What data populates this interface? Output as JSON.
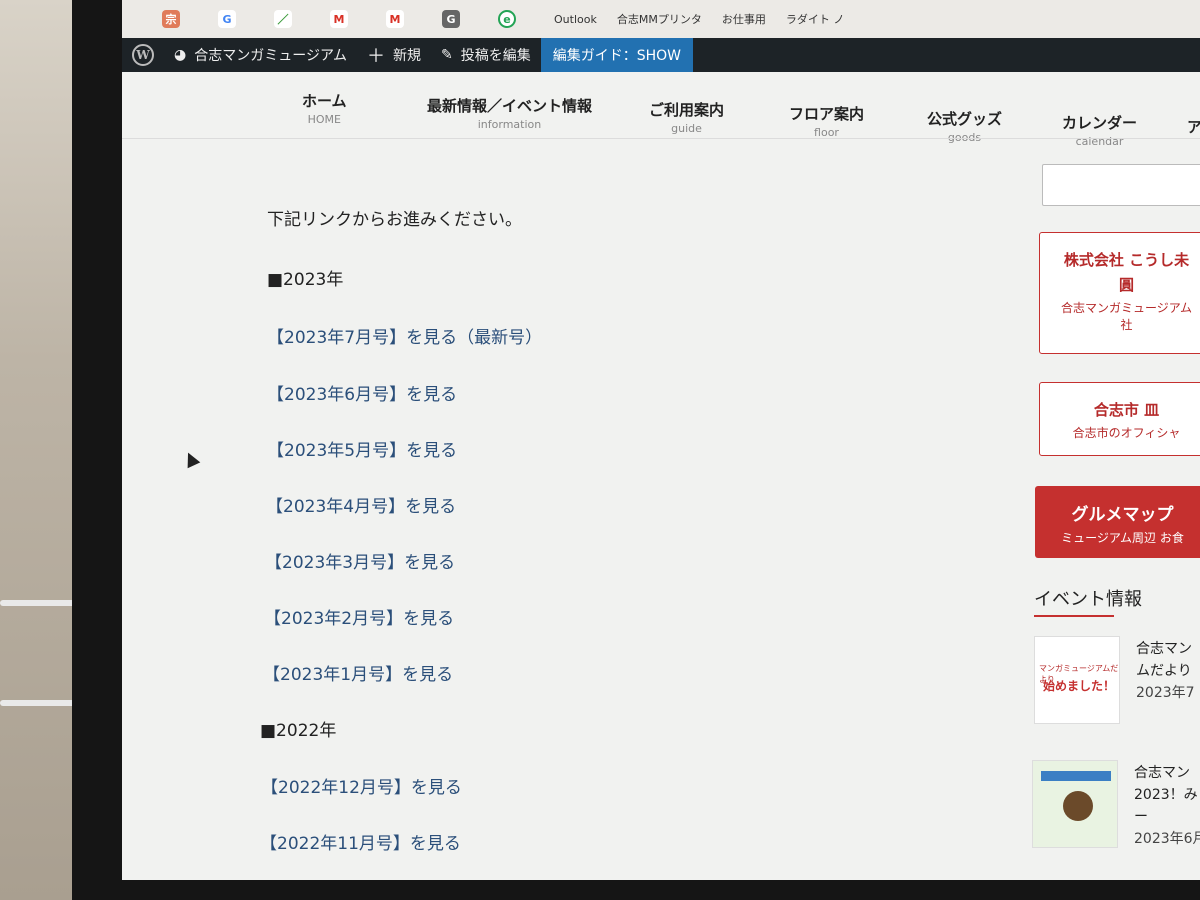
{
  "bookmarks": {
    "texts": [
      "Outlook",
      "合志MMプリンタ",
      "お仕事用",
      "ラダイト ノ"
    ]
  },
  "adminbar": {
    "site_name": "合志マンガミュージアム",
    "new_label": "新規",
    "edit_label": "投稿を編集",
    "guide_label": "編集ガイド：SHOW"
  },
  "nav": {
    "items": [
      {
        "ja": "ホーム",
        "en": "HOME"
      },
      {
        "ja": "最新情報／イベント情報",
        "en": "information"
      },
      {
        "ja": "ご利用案内",
        "en": "guide"
      },
      {
        "ja": "フロア案内",
        "en": "floor"
      },
      {
        "ja": "公式グッズ",
        "en": "goods"
      },
      {
        "ja": "カレンダー",
        "en": "calendar"
      },
      {
        "ja": "ア",
        "en": ""
      }
    ]
  },
  "content": {
    "intro": "下記リンクからお進みください。",
    "year_2023": "■2023年",
    "year_2022": "■2022年",
    "links": [
      "【2023年7月号】を見る（最新号）",
      "【2023年6月号】を見る",
      "【2023年5月号】を見る",
      "【2023年4月号】を見る",
      "【2023年3月号】を見る",
      "【2023年2月号】を見る",
      "【2023年1月号】を見る",
      "【2022年12月号】を見る",
      "【2022年11月号】を見る"
    ]
  },
  "sidebar": {
    "banner1": {
      "line1": "株式会社 こうし未",
      "line2": "圓",
      "line3": "合志マンガミュージアム",
      "line4": "社"
    },
    "banner2": {
      "line1": "合志市 皿",
      "line2": "合志市のオフィシャ"
    },
    "banner3": {
      "line1": "グルメマップ",
      "line2": "ミュージアム周辺 お食"
    },
    "events_title": "イベント情報",
    "posts": [
      {
        "title1": "合志マン",
        "title2": "ムだより",
        "date": "2023年7",
        "thumb_small": "マンガミュージアムだより",
        "thumb_big": "始めました！"
      },
      {
        "title1": "合志マン",
        "title2": "2023！み",
        "title3": "ー",
        "date": "2023年6月"
      }
    ]
  },
  "colors": {
    "admin_bar": "#1d2327",
    "guide_blue": "#2271b1",
    "link_blue": "#2b4f7a",
    "accent_red": "#c5302f"
  }
}
